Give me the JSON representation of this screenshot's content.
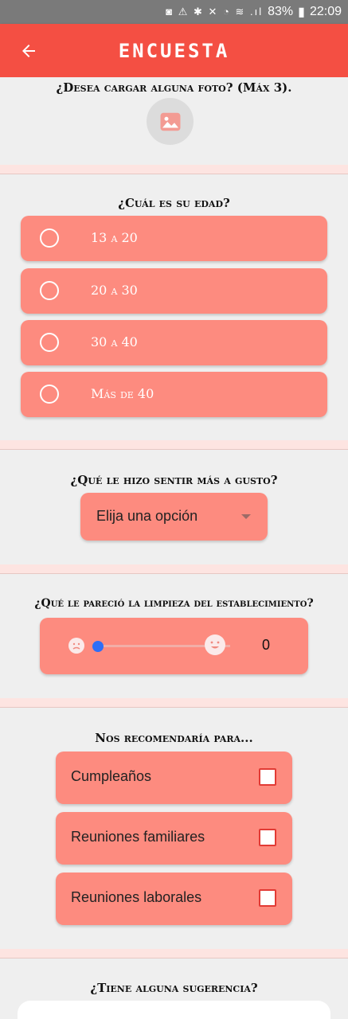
{
  "status_bar": {
    "battery": "83%",
    "time": "22:09",
    "icons": "◙ ⚠ ✱ ✕ ◔ ≋ .ıl"
  },
  "app_bar": {
    "title": "ENCUESTA"
  },
  "photo": {
    "question": "¿Desea cargar alguna foto? (Máx 3)."
  },
  "age": {
    "question": "¿Cuál es su edad?",
    "options": [
      "13 a 20",
      "20 a 30",
      "30 a 40",
      "Más de 40"
    ]
  },
  "liking": {
    "question": "¿Qué le hizo sentir más a gusto?",
    "selected": "Elija una opción"
  },
  "cleanliness": {
    "question": "¿Qué le pareció la limpieza del establecimiento?",
    "value": 0,
    "value_label": "0"
  },
  "recommend": {
    "question": "Nos recomendaría para...",
    "options": [
      "Cumpleaños",
      "Reuniones familiares",
      "Reuniones laborales"
    ]
  },
  "suggestion": {
    "question": "¿Tiene alguna sugerencia?"
  },
  "colors": {
    "accent": "#f44f43",
    "card": "#fd8b7f",
    "divider": "#fde4e1",
    "slider": "#2f6ef6"
  }
}
